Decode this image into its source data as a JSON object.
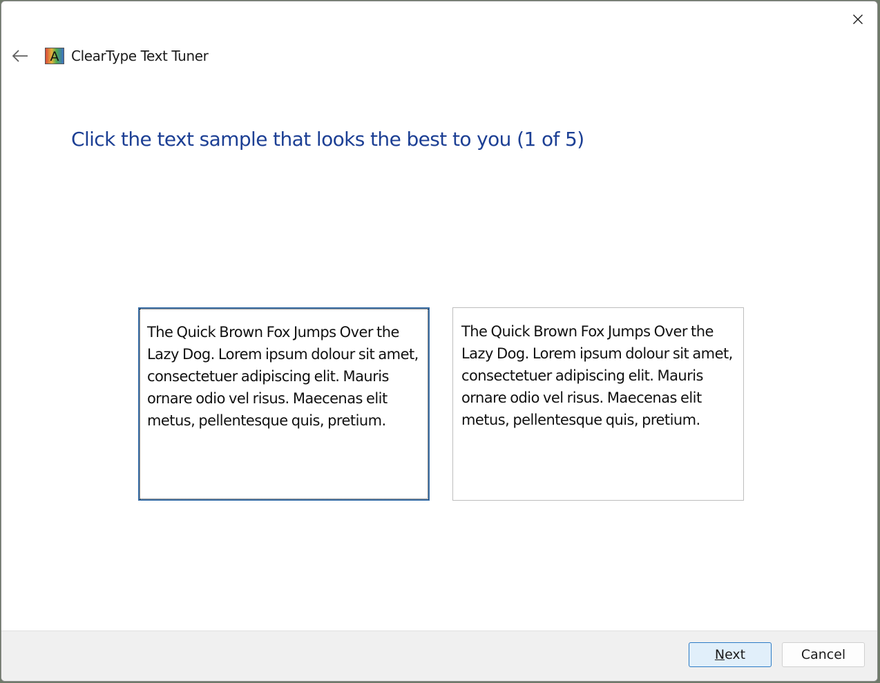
{
  "window": {
    "title": "ClearType Text Tuner",
    "close_icon": "close-icon",
    "back_icon": "back-arrow-icon",
    "app_icon": "cleartype-icon"
  },
  "main": {
    "instruction": "Click the text sample that looks the best to you (1 of 5)",
    "samples": [
      {
        "text": "The Quick Brown Fox Jumps Over the Lazy Dog. Lorem ipsum dolour sit amet, consectetuer adipiscing elit. Mauris ornare odio vel risus. Maecenas elit metus, pellentesque quis, pretium.",
        "selected": true
      },
      {
        "text": "The Quick Brown Fox Jumps Over the Lazy Dog. Lorem ipsum dolour sit amet, consectetuer adipiscing elit. Mauris ornare odio vel risus. Maecenas elit metus, pellentesque quis, pretium.",
        "selected": false
      }
    ]
  },
  "footer": {
    "next_label_access": "N",
    "next_label_rest": "ext",
    "cancel_label": "Cancel"
  },
  "colors": {
    "accent": "#1c3f94",
    "selected_border": "#3a6ea5",
    "default_button_border": "#2b7bc6",
    "default_button_bg": "#e1effa"
  }
}
